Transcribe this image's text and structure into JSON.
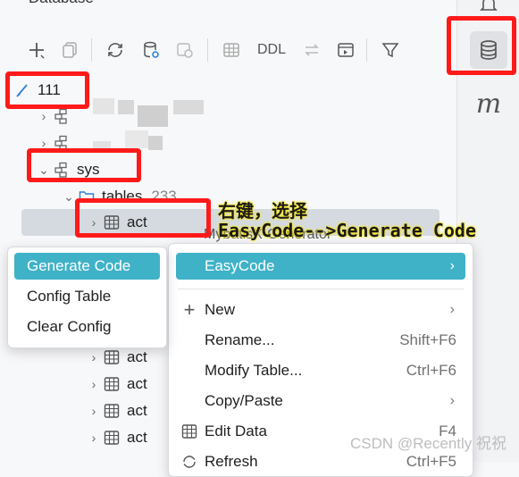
{
  "panel": {
    "title": "Database"
  },
  "toolbar": {
    "ddl_label": "DDL",
    "icons": [
      "add-icon",
      "copy-icon",
      "refresh-icon",
      "db-settings-icon",
      "jump-icon",
      "table-icon",
      "compare-icon",
      "console-icon",
      "filter-icon"
    ]
  },
  "right_strip": {
    "m_label": "m",
    "icons": [
      "bell-icon",
      "database-icon"
    ]
  },
  "tree": {
    "connection": "111",
    "schema": "sys",
    "tables_folder": "tables",
    "tables_count": "233",
    "selected_table": "act",
    "table_rows": [
      "act",
      "act",
      "act",
      "act"
    ]
  },
  "annotation": {
    "line1": "右键，选择",
    "line2": "EasyCode-->Generate Code",
    "partial_hidden": "MybatisX-Generator"
  },
  "easycode_submenu": {
    "items": [
      "Generate Code",
      "Config Table",
      "Clear Config"
    ],
    "highlighted_index": 0
  },
  "context_menu": {
    "items": [
      {
        "label": "EasyCode",
        "shortcut": "",
        "submenu": true,
        "highlighted": true
      },
      {
        "label": "New",
        "shortcut": "",
        "submenu": true,
        "icon": "plus-icon"
      },
      {
        "label": "Rename...",
        "shortcut": "Shift+F6"
      },
      {
        "label": "Modify Table...",
        "shortcut": "Ctrl+F6"
      },
      {
        "label": "Copy/Paste",
        "shortcut": "",
        "submenu": true
      },
      {
        "label": "Edit Data",
        "shortcut": "F4",
        "icon": "grid-icon"
      },
      {
        "label": "Refresh",
        "shortcut": "Ctrl+F5",
        "icon": "refresh-icon"
      }
    ]
  },
  "watermark": "CSDN @Recently 祝祝",
  "colors": {
    "highlight": "#3fb2c7",
    "red_box": "#ff1a1a",
    "annotation_glow": "#ffea00",
    "selected_row": "#d5dae1"
  }
}
